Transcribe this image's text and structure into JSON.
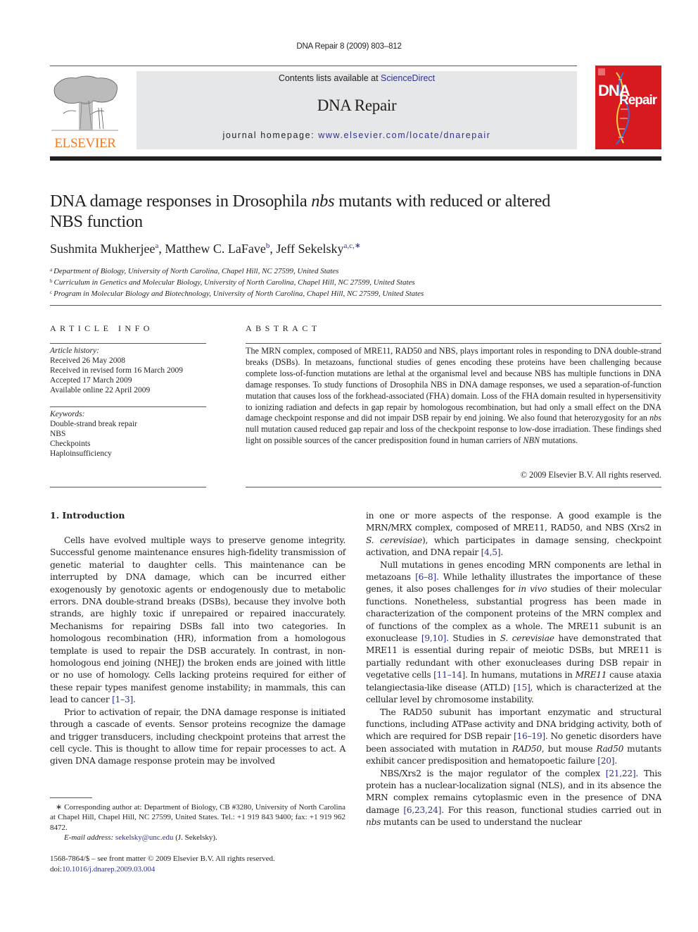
{
  "running_head": "DNA Repair 8 (2009) 803–812",
  "banner": {
    "contents_prefix": "Contents lists available at ",
    "contents_link": "ScienceDirect",
    "journal_name": "DNA Repair",
    "homepage_prefix": "journal homepage: ",
    "homepage_link": "www.elsevier.com/locate/dnarepair"
  },
  "publisher_logo": {
    "wordmark": "ELSEVIER",
    "color": "#f47920"
  },
  "cover": {
    "line1": "DNA",
    "line2": "Repair",
    "color": "#d71920"
  },
  "title": {
    "part1": "DNA damage responses in Drosophila ",
    "italic": "nbs",
    "part2": " mutants with reduced or altered NBS function"
  },
  "authors": [
    {
      "name": "Sushmita Mukherjee",
      "sup": "a"
    },
    {
      "name": "Matthew C. LaFave",
      "sup": "b"
    },
    {
      "name": "Jeff Sekelsky",
      "sup": "a,c,∗"
    }
  ],
  "affiliations": [
    {
      "mark": "a",
      "text": "Department of Biology, University of North Carolina, Chapel Hill, NC 27599, United States"
    },
    {
      "mark": "b",
      "text": "Curriculum in Genetics and Molecular Biology, University of North Carolina, Chapel Hill, NC 27599, United States"
    },
    {
      "mark": "c",
      "text": "Program in Molecular Biology and Biotechnology, University of North Carolina, Chapel Hill, NC 27599, United States"
    }
  ],
  "article_info": {
    "heading": "ARTICLE INFO",
    "history_label": "Article history:",
    "history": [
      "Received 26 May 2008",
      "Received in revised form 16 March 2009",
      "Accepted 17 March 2009",
      "Available online 22 April 2009"
    ],
    "keywords_label": "Keywords:",
    "keywords": [
      "Double-strand break repair",
      "NBS",
      "Checkpoints",
      "Haploinsufficiency"
    ]
  },
  "abstract": {
    "heading": "ABSTRACT",
    "text1": "The MRN complex, composed of MRE11, RAD50 and NBS, plays important roles in responding to DNA double-strand breaks (DSBs). In metazoans, functional studies of genes encoding these proteins have been challenging because complete loss-of-function mutations are lethal at the organismal level and because NBS has multiple functions in DNA damage responses. To study functions of Drosophila NBS in DNA damage responses, we used a separation-of-function mutation that causes loss of the forkhead-associated (FHA) domain. Loss of the FHA domain resulted in hypersensitivity to ionizing radiation and defects in gap repair by homologous recombination, but had only a small effect on the DNA damage checkpoint response and did not impair DSB repair by end joining. We also found that heterozygosity for an ",
    "italic1": "nbs",
    "text2": " null mutation caused reduced gap repair and loss of the checkpoint response to low-dose irradiation. These findings shed light on possible sources of the cancer predisposition found in human carriers of ",
    "italic2": "NBN",
    "text3": " mutations.",
    "copyright": "© 2009 Elsevier B.V. All rights reserved."
  },
  "section1": {
    "heading": "1.  Introduction",
    "p1_text": "Cells have evolved multiple ways to preserve genome integrity. Successful genome maintenance ensures high-fidelity transmission of genetic material to daughter cells. This maintenance can be interrupted by DNA damage, which can be incurred either exogenously by genotoxic agents or endogenously due to metabolic errors. DNA double-strand breaks (DSBs), because they involve both strands, are highly toxic if unrepaired or repaired inaccurately. Mechanisms for repairing DSBs fall into two categories. In homologous recombination (HR), information from a homologous template is used to repair the DSB accurately. In contrast, in non-homologous end joining (NHEJ) the broken ends are joined with little or no use of homology. Cells lacking proteins required for either of these repair types manifest genome instability; in mammals, this can lead to cancer ",
    "p1_ref": "[1–3]",
    "p1_end": ".",
    "p2_text": "Prior to activation of repair, the DNA damage response is initiated through a cascade of events. Sensor proteins recognize the damage and trigger transducers, including checkpoint proteins that arrest the cell cycle. This is thought to allow time for repair processes to act. A given DNA damage response protein may be involved",
    "p2b_text1": "in one or more aspects of the response. A good example is the MRN/MRX complex, composed of MRE11, RAD50, and NBS (Xrs2 in ",
    "p2b_it1": "S. cerevisiae",
    "p2b_text2": "), which participates in damage sensing, checkpoint activation, and DNA repair ",
    "p2b_ref": "[4,5]",
    "p2b_end": ".",
    "p3_text1": "Null mutations in genes encoding MRN components are lethal in metazoans ",
    "p3_ref1": "[6–8]",
    "p3_text2": ". While lethality illustrates the importance of these genes, it also poses challenges for ",
    "p3_it1": "in vivo",
    "p3_text3": " studies of their molecular functions. Nonetheless, substantial progress has been made in characterization of the component proteins of the MRN complex and of functions of the complex as a whole. The MRE11 subunit is an exonuclease ",
    "p3_ref2": "[9,10]",
    "p3_text4": ". Studies in ",
    "p3_it2": "S. cerevisiae",
    "p3_text5": " have demonstrated that MRE11 is essential during repair of meiotic DSBs, but MRE11 is partially redundant with other exonucleases during DSB repair in vegetative cells ",
    "p3_ref3": "[11–14]",
    "p3_text6": ". In humans, mutations in ",
    "p3_it3": "MRE11",
    "p3_text7": " cause ataxia telangiectasia-like disease (ATLD) ",
    "p3_ref4": "[15]",
    "p3_text8": ", which is characterized at the cellular level by chromosome instability.",
    "p4_text1": "The RAD50 subunit has important enzymatic and structural functions, including ATPase activity and DNA bridging activity, both of which are required for DSB repair ",
    "p4_ref1": "[16–19]",
    "p4_text2": ". No genetic disorders have been associated with mutation in ",
    "p4_it1": "RAD50",
    "p4_text3": ", but mouse ",
    "p4_it2": "Rad50",
    "p4_text4": " mutants exhibit cancer predisposition and hematopoetic failure ",
    "p4_ref2": "[20]",
    "p4_end": ".",
    "p5_text1": "NBS/Xrs2 is the major regulator of the complex ",
    "p5_ref1": "[21,22]",
    "p5_text2": ". This protein has a nuclear-localization signal (NLS), and in its absence the MRN complex remains cytoplasmic even in the presence of DNA damage ",
    "p5_ref2": "[6,23,24]",
    "p5_text3": ". For this reason, functional studies carried out in ",
    "p5_it1": "nbs",
    "p5_text4": " mutants can be used to understand the nuclear"
  },
  "footnote": {
    "star": "∗",
    "text": " Corresponding author at: Department of Biology, CB #3280, University of North Carolina at Chapel Hill, Chapel Hill, NC 27599, United States. Tel.: +1 919 843 9400; fax: +1 919 962 8472.",
    "email_label": "E-mail address: ",
    "email": "sekelsky@unc.edu",
    "email_suffix": " (J. Sekelsky)."
  },
  "front_matter": {
    "issn_line": "1568-7864/$ – see front matter © 2009 Elsevier B.V. All rights reserved.",
    "doi_label": "doi:",
    "doi": "10.1016/j.dnarep.2009.03.004"
  }
}
